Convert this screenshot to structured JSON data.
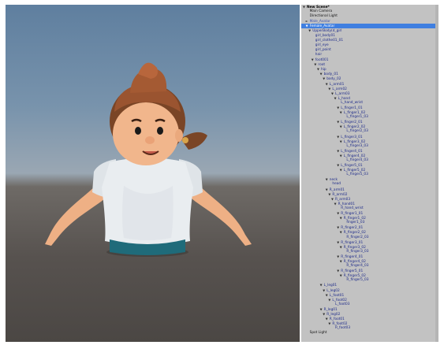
{
  "hierarchy": {
    "rows": [
      {
        "label": "New Scene*",
        "depth": 0,
        "arrow": "▼",
        "style": "scene",
        "icon": "unity-scene-icon"
      },
      {
        "label": "Main Camera",
        "depth": 1,
        "arrow": "",
        "style": "plain"
      },
      {
        "label": "Directional Light",
        "depth": 1,
        "arrow": "",
        "style": "plain"
      },
      {
        "label": "Male_Avatar",
        "depth": 1,
        "arrow": "►",
        "style": "prefab"
      },
      {
        "label": "Female_Avatar",
        "depth": 1,
        "arrow": "▼",
        "style": "sel"
      },
      {
        "label": "UpperBody(d_girl",
        "depth": 2,
        "arrow": "▼",
        "style": ""
      },
      {
        "label": "girl_body01",
        "depth": 3,
        "arrow": "",
        "style": ""
      },
      {
        "label": "girl_clothe01_01",
        "depth": 3,
        "arrow": "",
        "style": ""
      },
      {
        "label": "girl_eye",
        "depth": 3,
        "arrow": "",
        "style": ""
      },
      {
        "label": "girl_point",
        "depth": 3,
        "arrow": "",
        "style": ""
      },
      {
        "label": "hair",
        "depth": 3,
        "arrow": "",
        "style": ""
      },
      {
        "label": "foot001",
        "depth": 3,
        "arrow": "▼",
        "style": ""
      },
      {
        "label": "root",
        "depth": 4,
        "arrow": "▼",
        "style": ""
      },
      {
        "label": "hip",
        "depth": 5,
        "arrow": "▼",
        "style": ""
      },
      {
        "label": "body_01",
        "depth": 6,
        "arrow": "▼",
        "style": ""
      },
      {
        "label": "body_02",
        "depth": 7,
        "arrow": "▼",
        "style": ""
      },
      {
        "label": "L_arm01",
        "depth": 8,
        "arrow": "▼",
        "style": ""
      },
      {
        "label": "L_arm02",
        "depth": 9,
        "arrow": "▼",
        "style": ""
      },
      {
        "label": "L_arm03",
        "depth": 10,
        "arrow": "▼",
        "style": ""
      },
      {
        "label": "L_hand",
        "depth": 11,
        "arrow": "▼",
        "style": ""
      },
      {
        "label": "L_hand_wrist",
        "depth": 12,
        "arrow": "",
        "style": ""
      },
      {
        "label": "L_finger1_01",
        "depth": 12,
        "arrow": "▼",
        "style": ""
      },
      {
        "label": "L_finger1_02",
        "depth": 13,
        "arrow": "▼",
        "style": ""
      },
      {
        "label": "L_finger1_03",
        "depth": 14,
        "arrow": "",
        "style": ""
      },
      {
        "label": "L_finger2_01",
        "depth": 12,
        "arrow": "▼",
        "style": ""
      },
      {
        "label": "L_finger2_02",
        "depth": 13,
        "arrow": "▼",
        "style": ""
      },
      {
        "label": "L_finger2_03",
        "depth": 14,
        "arrow": "",
        "style": ""
      },
      {
        "label": "L_finger3_01",
        "depth": 12,
        "arrow": "▼",
        "style": ""
      },
      {
        "label": "L_finger3_02",
        "depth": 13,
        "arrow": "▼",
        "style": ""
      },
      {
        "label": "L_finger3_03",
        "depth": 14,
        "arrow": "",
        "style": ""
      },
      {
        "label": "L_finger4_01",
        "depth": 12,
        "arrow": "▼",
        "style": ""
      },
      {
        "label": "L_finger4_02",
        "depth": 13,
        "arrow": "▼",
        "style": ""
      },
      {
        "label": "L_finger4_03",
        "depth": 14,
        "arrow": "",
        "style": ""
      },
      {
        "label": "L_finger5_01",
        "depth": 12,
        "arrow": "▼",
        "style": ""
      },
      {
        "label": "L_finger5_02",
        "depth": 13,
        "arrow": "▼",
        "style": ""
      },
      {
        "label": "L_finger5_03",
        "depth": 14,
        "arrow": "",
        "style": ""
      },
      {
        "label": "neck",
        "depth": 8,
        "arrow": "▼",
        "style": ""
      },
      {
        "label": "head",
        "depth": 9,
        "arrow": "",
        "style": ""
      },
      {
        "label": "R_arm01",
        "depth": 8,
        "arrow": "▼",
        "style": ""
      },
      {
        "label": "R_arm02",
        "depth": 9,
        "arrow": "▼",
        "style": ""
      },
      {
        "label": "R_arm03",
        "depth": 10,
        "arrow": "▼",
        "style": ""
      },
      {
        "label": "R_hand01",
        "depth": 11,
        "arrow": "▼",
        "style": ""
      },
      {
        "label": "R_hand_wrist",
        "depth": 12,
        "arrow": "",
        "style": ""
      },
      {
        "label": "R_finger1_01",
        "depth": 12,
        "arrow": "▼",
        "style": ""
      },
      {
        "label": "R_finger1_02",
        "depth": 13,
        "arrow": "▼",
        "style": ""
      },
      {
        "label": "finger1_03",
        "depth": 14,
        "arrow": "",
        "style": ""
      },
      {
        "label": "R_finger2_01",
        "depth": 12,
        "arrow": "▼",
        "style": ""
      },
      {
        "label": "R_finger2_02",
        "depth": 13,
        "arrow": "▼",
        "style": ""
      },
      {
        "label": "R_finger2_03",
        "depth": 14,
        "arrow": "",
        "style": ""
      },
      {
        "label": "R_finger3_01",
        "depth": 12,
        "arrow": "▼",
        "style": ""
      },
      {
        "label": "R_finger3_02",
        "depth": 13,
        "arrow": "▼",
        "style": ""
      },
      {
        "label": "R_finger3_03",
        "depth": 14,
        "arrow": "",
        "style": ""
      },
      {
        "label": "R_finger4_01",
        "depth": 12,
        "arrow": "▼",
        "style": ""
      },
      {
        "label": "R_finger4_02",
        "depth": 13,
        "arrow": "▼",
        "style": ""
      },
      {
        "label": "R_finger4_03",
        "depth": 14,
        "arrow": "",
        "style": ""
      },
      {
        "label": "R_finger5_01",
        "depth": 12,
        "arrow": "▼",
        "style": ""
      },
      {
        "label": "R_finger5_02",
        "depth": 13,
        "arrow": "▼",
        "style": ""
      },
      {
        "label": "R_finger5_03",
        "depth": 14,
        "arrow": "",
        "style": ""
      },
      {
        "label": "L_leg01",
        "depth": 6,
        "arrow": "▼",
        "style": ""
      },
      {
        "label": "L_leg02",
        "depth": 7,
        "arrow": "▼",
        "style": ""
      },
      {
        "label": "L_foot01",
        "depth": 8,
        "arrow": "▼",
        "style": ""
      },
      {
        "label": "L_foot02",
        "depth": 9,
        "arrow": "▼",
        "style": ""
      },
      {
        "label": "L_foot03",
        "depth": 10,
        "arrow": "",
        "style": ""
      },
      {
        "label": "R_leg01",
        "depth": 6,
        "arrow": "▼",
        "style": ""
      },
      {
        "label": "R_leg02",
        "depth": 7,
        "arrow": "▼",
        "style": ""
      },
      {
        "label": "R_foot01",
        "depth": 8,
        "arrow": "▼",
        "style": ""
      },
      {
        "label": "R_foot02",
        "depth": 9,
        "arrow": "▼",
        "style": ""
      },
      {
        "label": "R_foot03",
        "depth": 10,
        "arrow": "",
        "style": ""
      },
      {
        "label": "Spot Light",
        "depth": 1,
        "arrow": "",
        "style": "plain"
      }
    ]
  },
  "colors": {
    "selection": "#3f7fe0",
    "hierarchy_bg": "#c2c2c2",
    "hair": "#9a5430",
    "shirt": "#e8ecef",
    "skin": "#f0b489"
  }
}
